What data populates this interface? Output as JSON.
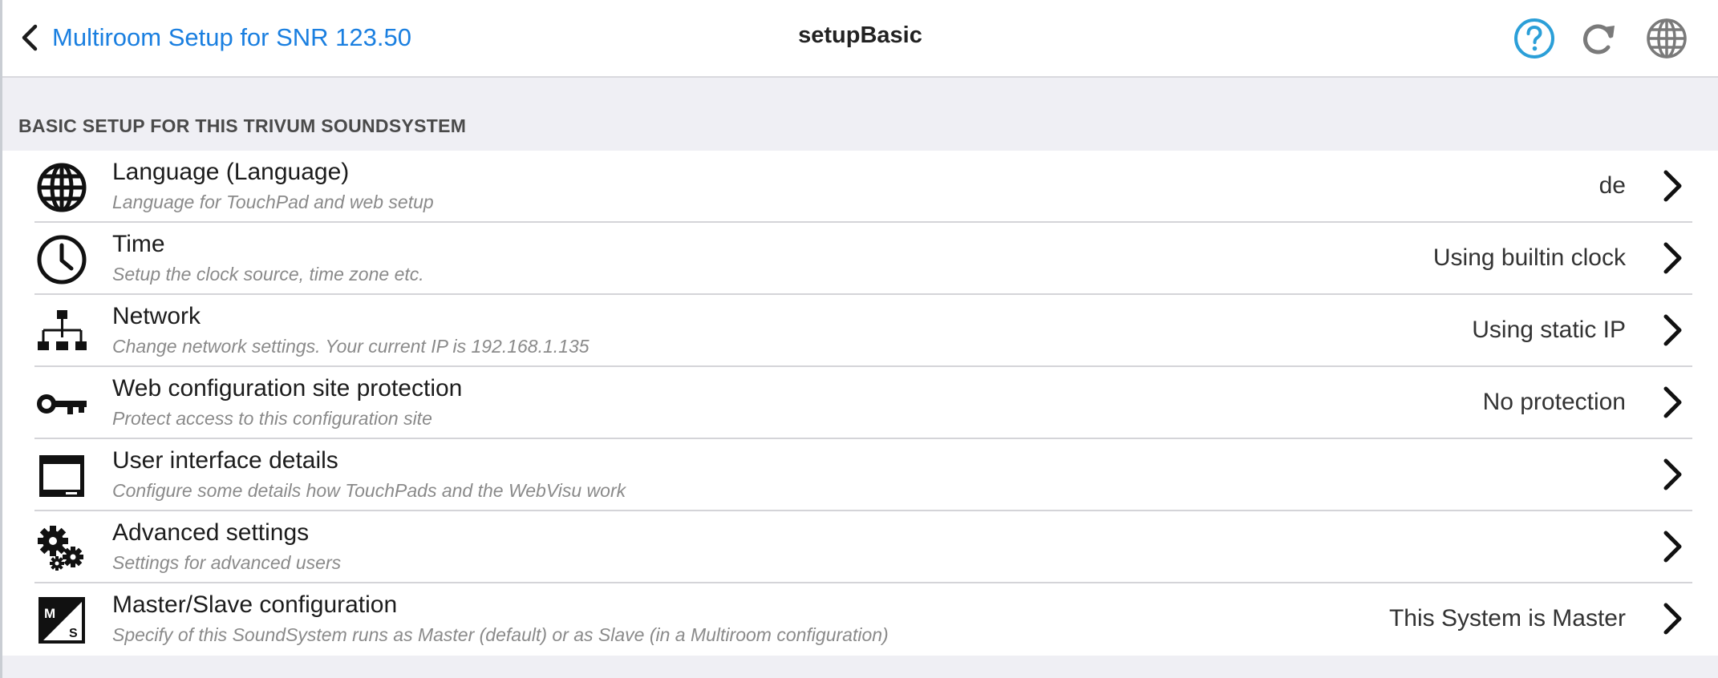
{
  "header": {
    "back_label": "Multiroom Setup for SNR 123.50",
    "title": "setupBasic",
    "icons": [
      "help-icon",
      "refresh-icon",
      "globe-icon"
    ],
    "accent_color": "#1a7fe0",
    "help_color": "#2b9fd8"
  },
  "section": {
    "title": "BASIC SETUP FOR THIS TRIVUM SOUNDSYSTEM"
  },
  "items": [
    {
      "icon": "globe-icon",
      "title": "Language (Language)",
      "description": "Language for TouchPad and web setup",
      "value": "de"
    },
    {
      "icon": "clock-icon",
      "title": "Time",
      "description": "Setup the clock source, time zone etc.",
      "value": "Using builtin clock"
    },
    {
      "icon": "network-icon",
      "title": "Network",
      "description": "Change network settings. Your current IP is 192.168.1.135",
      "value": "Using static IP"
    },
    {
      "icon": "key-icon",
      "title": "Web configuration site protection",
      "description": "Protect access to this configuration site",
      "value": "No protection"
    },
    {
      "icon": "window-icon",
      "title": "User interface details",
      "description": "Configure some details how TouchPads and the WebVisu work",
      "value": ""
    },
    {
      "icon": "gears-icon",
      "title": "Advanced settings",
      "description": "Settings for advanced users",
      "value": ""
    },
    {
      "icon": "master-slave-icon",
      "title": "Master/Slave configuration",
      "description": "Specify of this SoundSystem runs as Master (default) or as Slave (in a Multiroom configuration)",
      "value": "This System is Master"
    }
  ]
}
